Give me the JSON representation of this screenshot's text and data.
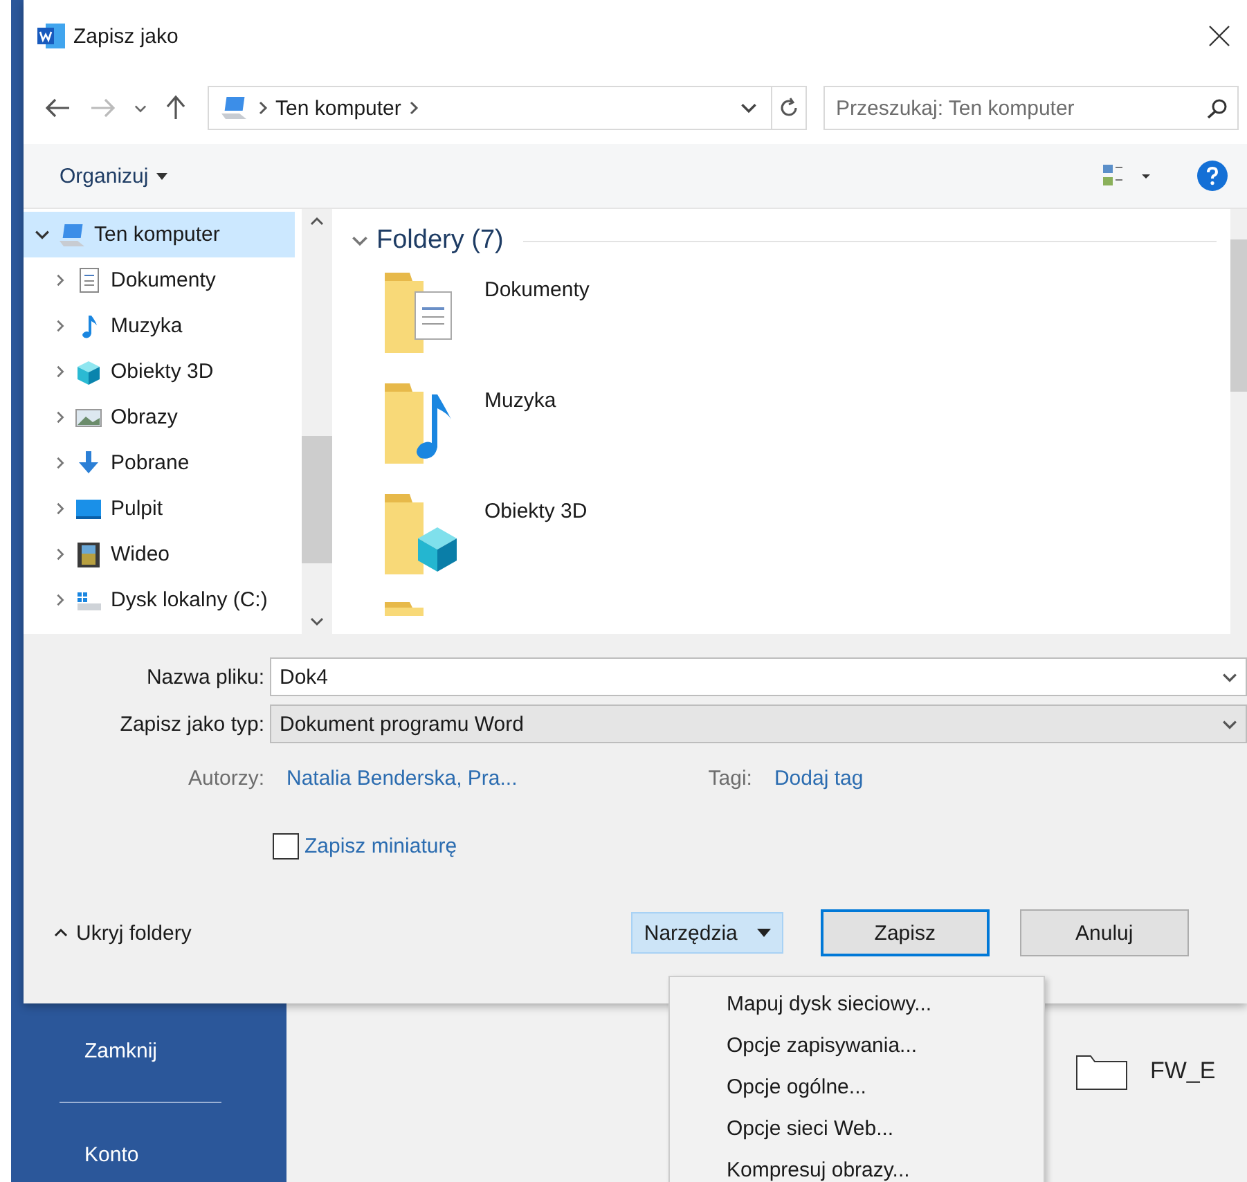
{
  "window": {
    "title": "Zapisz jako"
  },
  "address_bar": {
    "path": [
      "Ten komputer"
    ]
  },
  "search": {
    "placeholder": "Przeszukaj: Ten komputer"
  },
  "toolbar": {
    "organize": "Organizuj"
  },
  "navigation_tree": [
    {
      "label": "Ten komputer",
      "kind": "computer",
      "expanded": true,
      "selected": true,
      "children": [
        {
          "label": "Dokumenty",
          "kind": "documents",
          "expanded": false,
          "selected": false
        },
        {
          "label": "Muzyka",
          "kind": "music",
          "expanded": false,
          "selected": false
        },
        {
          "label": "Obiekty 3D",
          "kind": "cube",
          "expanded": false,
          "selected": false
        },
        {
          "label": "Obrazy",
          "kind": "pictures",
          "expanded": false,
          "selected": false
        },
        {
          "label": "Pobrane",
          "kind": "downloads",
          "expanded": false,
          "selected": false
        },
        {
          "label": "Pulpit",
          "kind": "desktop",
          "expanded": false,
          "selected": false
        },
        {
          "label": "Wideo",
          "kind": "videos",
          "expanded": false,
          "selected": false
        },
        {
          "label": "Dysk lokalny (C:)",
          "kind": "drive",
          "expanded": false,
          "selected": false
        }
      ]
    }
  ],
  "folders_group": {
    "title": "Foldery (7)",
    "expanded": true,
    "items": [
      {
        "label": "Dokumenty",
        "kind": "documents"
      },
      {
        "label": "Muzyka",
        "kind": "music"
      },
      {
        "label": "Obiekty 3D",
        "kind": "cube"
      }
    ]
  },
  "form": {
    "file_name": {
      "label": "Nazwa pliku:",
      "value": "Dok4"
    },
    "file_type": {
      "label": "Zapisz jako typ:",
      "value": "Dokument programu Word"
    },
    "authors": {
      "label": "Autorzy:",
      "value": "Natalia Benderska, Pra..."
    },
    "tags": {
      "label": "Tagi:",
      "value": "Dodaj tag"
    },
    "thumbnail": {
      "label": "Zapisz miniaturę",
      "checked": false
    }
  },
  "footer": {
    "hide_folders": "Ukryj foldery",
    "tools": {
      "label": "Narzędzia",
      "open": true,
      "items": [
        "Mapuj dysk sieciowy...",
        "Opcje zapisywania...",
        "Opcje ogólne...",
        "Opcje sieci Web...",
        "Kompresuj obrazy..."
      ]
    },
    "buttons": [
      {
        "label": "Zapisz",
        "default": true
      },
      {
        "label": "Anuluj",
        "default": false
      }
    ]
  },
  "backstage": {
    "nav": [
      "Zamknij",
      "Konto"
    ],
    "files": [
      "FW_E"
    ]
  }
}
